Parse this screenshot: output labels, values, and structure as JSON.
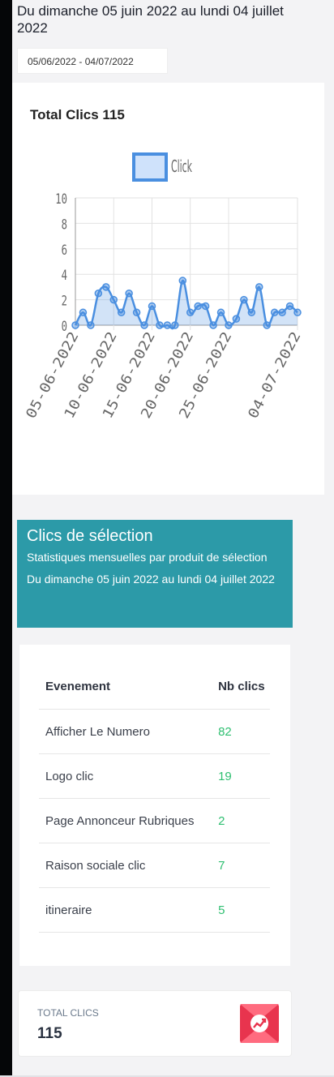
{
  "header": {
    "title": "Du dimanche 05 juin 2022 au lundi 04 juillet 2022",
    "date_range": "05/06/2022 - 04/07/2022"
  },
  "chart_card": {
    "title": "Total Clics 115"
  },
  "chart_data": {
    "type": "line",
    "title": "Total Clics 115",
    "x": [
      "05-06-2022",
      "06-06-2022",
      "07-06-2022",
      "08-06-2022",
      "09-06-2022",
      "10-06-2022",
      "11-06-2022",
      "12-06-2022",
      "13-06-2022",
      "14-06-2022",
      "15-06-2022",
      "16-06-2022",
      "17-06-2022",
      "18-06-2022",
      "19-06-2022",
      "20-06-2022",
      "21-06-2022",
      "22-06-2022",
      "23-06-2022",
      "24-06-2022",
      "25-06-2022",
      "26-06-2022",
      "27-06-2022",
      "28-06-2022",
      "29-06-2022",
      "30-06-2022",
      "01-07-2022",
      "02-07-2022",
      "03-07-2022",
      "04-07-2022"
    ],
    "x_tick_labels": [
      "05-06-2022",
      "10-06-2022",
      "15-06-2022",
      "20-06-2022",
      "25-06-2022",
      "04-07-2022"
    ],
    "series": [
      {
        "name": "Click",
        "values": [
          0,
          1,
          0,
          2.5,
          3,
          2,
          1,
          2.5,
          1,
          0,
          1.5,
          0,
          0,
          0,
          3.5,
          1,
          1.5,
          1.5,
          0,
          1,
          0,
          0.5,
          2,
          1,
          3,
          0,
          1,
          1,
          1.5,
          1
        ]
      }
    ],
    "ylim": [
      0,
      10
    ],
    "yticks": [
      0,
      2,
      4,
      6,
      8,
      10
    ],
    "grid": true,
    "legend_position": "top",
    "color": "#4a8fe0"
  },
  "selection": {
    "title": "Clics de sélection",
    "subtitle": "Statistiques mensuelles par produit de sélection Du dimanche 05 juin 2022 au lundi 04 juillet 2022"
  },
  "table": {
    "headers": [
      "Evenement",
      "Nb clics"
    ],
    "rows": [
      {
        "event": "Afficher Le Numero",
        "clicks": "82"
      },
      {
        "event": "Logo clic",
        "clicks": "19"
      },
      {
        "event": "Page Annonceur Rubriques",
        "clicks": "2"
      },
      {
        "event": "Raison sociale clic",
        "clicks": "7"
      },
      {
        "event": "itineraire",
        "clicks": "5"
      }
    ]
  },
  "total": {
    "label": "TOTAL CLICS",
    "value": "115",
    "icon": "chart-growth-icon",
    "icon_color": "#e8344e"
  }
}
